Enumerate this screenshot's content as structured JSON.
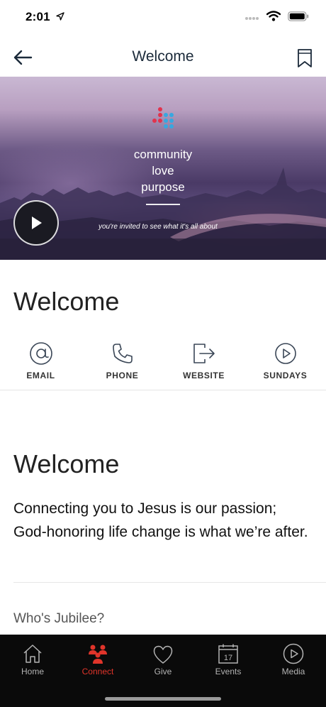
{
  "status": {
    "time": "2:01"
  },
  "nav": {
    "title": "Welcome"
  },
  "hero": {
    "line1": "community",
    "line2": "love",
    "line3": "purpose",
    "tagline": "you're invited to see what it's all about"
  },
  "page": {
    "title": "Welcome"
  },
  "actions": [
    {
      "label": "EMAIL",
      "icon": "at-icon"
    },
    {
      "label": "PHONE",
      "icon": "phone-icon"
    },
    {
      "label": "WEBSITE",
      "icon": "external-link-icon"
    },
    {
      "label": "SUNDAYS",
      "icon": "play-circle-icon"
    }
  ],
  "content": {
    "title": "Welcome",
    "body": "Connecting you to Jesus is our passion; God-honoring life change is what we’re after.",
    "subheading": "Who's Jubilee?"
  },
  "tabs": [
    {
      "label": "Home",
      "icon": "home-icon",
      "active": false
    },
    {
      "label": "Connect",
      "icon": "people-icon",
      "active": true
    },
    {
      "label": "Give",
      "icon": "heart-icon",
      "active": false
    },
    {
      "label": "Events",
      "icon": "calendar-icon",
      "active": false,
      "calendar_day": "17"
    },
    {
      "label": "Media",
      "icon": "play-circle-icon",
      "active": false
    }
  ],
  "colors": {
    "active_tab": "#e0342a",
    "tab_bar_bg": "#0a0a0a",
    "nav_title": "#1b2a3a"
  }
}
